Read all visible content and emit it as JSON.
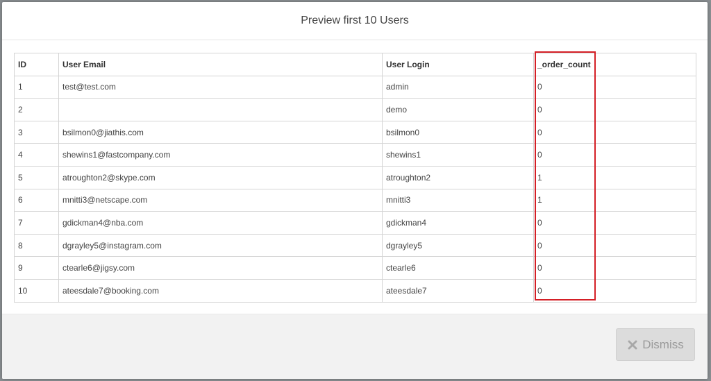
{
  "modal": {
    "title": "Preview first 10 Users",
    "dismiss_label": "Dismiss"
  },
  "table": {
    "headers": {
      "id": "ID",
      "email": "User Email",
      "login": "User Login",
      "order_count": "_order_count"
    },
    "rows": [
      {
        "id": "1",
        "email": "test@test.com",
        "login": "admin",
        "order_count": "0"
      },
      {
        "id": "2",
        "email": "",
        "login": "demo",
        "order_count": "0"
      },
      {
        "id": "3",
        "email": "bsilmon0@jiathis.com",
        "login": "bsilmon0",
        "order_count": "0"
      },
      {
        "id": "4",
        "email": "shewins1@fastcompany.com",
        "login": "shewins1",
        "order_count": "0"
      },
      {
        "id": "5",
        "email": "atroughton2@skype.com",
        "login": "atroughton2",
        "order_count": "1"
      },
      {
        "id": "6",
        "email": "mnitti3@netscape.com",
        "login": "mnitti3",
        "order_count": "1"
      },
      {
        "id": "7",
        "email": "gdickman4@nba.com",
        "login": "gdickman4",
        "order_count": "0"
      },
      {
        "id": "8",
        "email": "dgrayley5@instagram.com",
        "login": "dgrayley5",
        "order_count": "0"
      },
      {
        "id": "9",
        "email": "ctearle6@jigsy.com",
        "login": "ctearle6",
        "order_count": "0"
      },
      {
        "id": "10",
        "email": "ateesdale7@booking.com",
        "login": "ateesdale7",
        "order_count": "0"
      }
    ]
  },
  "colors": {
    "highlight": "#d41f26",
    "footer_bg": "#f2f2f2",
    "button_bg": "#dcdcdc"
  },
  "icons": {
    "dismiss": "close-icon"
  }
}
